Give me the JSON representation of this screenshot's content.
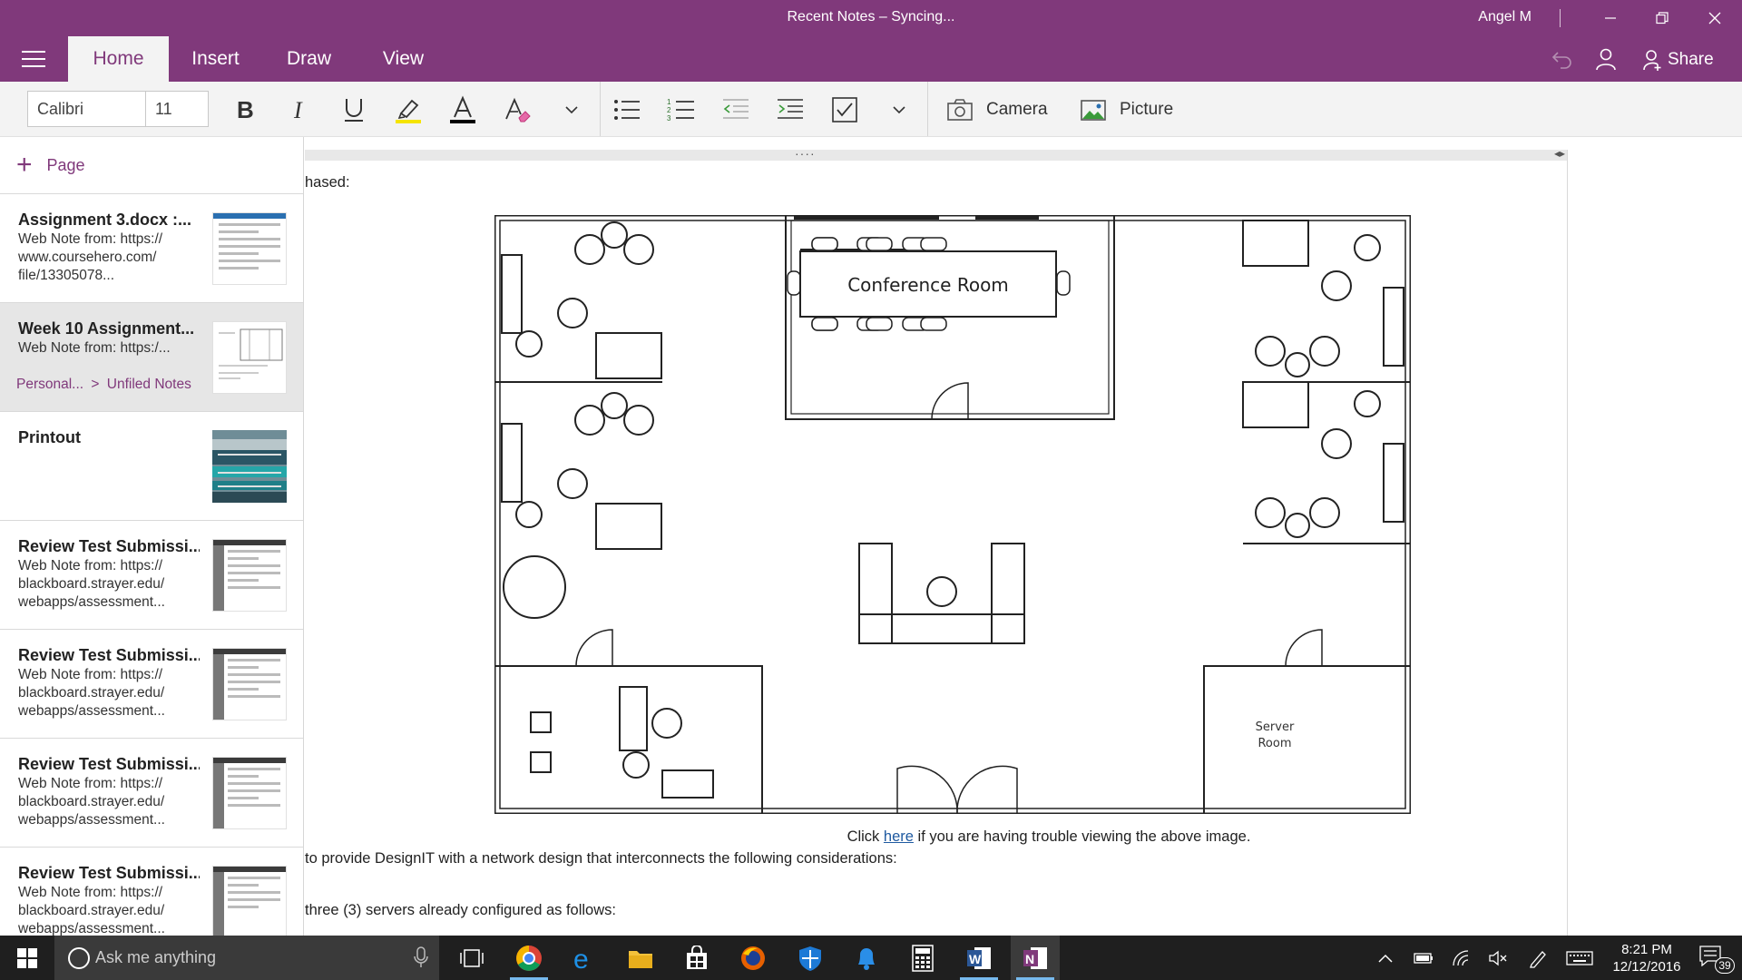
{
  "window": {
    "title": "Recent Notes – Syncing...",
    "user": "Angel M"
  },
  "tabs": [
    {
      "label": "Home"
    },
    {
      "label": "Insert"
    },
    {
      "label": "Draw"
    },
    {
      "label": "View"
    }
  ],
  "share_label": "Share",
  "ribbon": {
    "font_name": "Calibri",
    "font_size": "11",
    "camera_label": "Camera",
    "picture_label": "Picture",
    "highlight_color": "#f5e400",
    "font_color": "#000000"
  },
  "pages_pane": {
    "add_page_label": "Page",
    "items": [
      {
        "title": "Assignment 3.docx :...",
        "sub1": "Web Note from: https://",
        "sub2": "www.coursehero.com/",
        "sub3": "file/13305078..."
      },
      {
        "title": "Week 10 Assignment...",
        "sub1": "Web Note from: https:/...",
        "crumb_section": "Personal...",
        "crumb_sep": ">",
        "crumb_page": "Unfiled Notes"
      },
      {
        "title": "Printout"
      },
      {
        "title": "Review Test Submissi...",
        "sub1": "Web Note from: https://",
        "sub2": "blackboard.strayer.edu/",
        "sub3": "webapps/assessment..."
      },
      {
        "title": "Review Test Submissi...",
        "sub1": "Web Note from: https://",
        "sub2": "blackboard.strayer.edu/",
        "sub3": "webapps/assessment..."
      },
      {
        "title": "Review Test Submissi...",
        "sub1": "Web Note from: https://",
        "sub2": "blackboard.strayer.edu/",
        "sub3": "webapps/assessment..."
      },
      {
        "title": "Review Test Submissi...",
        "sub1": "Web Note from: https://",
        "sub2": "blackboard.strayer.edu/",
        "sub3": "webapps/assessment..."
      }
    ]
  },
  "content": {
    "line_top": "hased:",
    "floorplan": {
      "conference_label": "Conference Room",
      "server_label_1": "Server",
      "server_label_2": "Room"
    },
    "caption_before": "Click ",
    "caption_link": "here",
    "caption_after": " if you are having trouble viewing the above image.",
    "line_1": "to provide DesignIT with a network design that interconnects the following considerations:",
    "line_2": "three (3) servers already configured as follows:"
  },
  "taskbar": {
    "search_placeholder": "Ask me anything",
    "time": "8:21 PM",
    "date": "12/12/2016",
    "notification_count": "39"
  },
  "colors": {
    "accent": "#80397b",
    "taskbar": "#1f1f1f"
  }
}
